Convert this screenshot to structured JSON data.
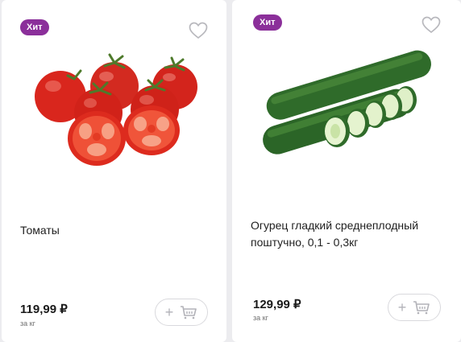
{
  "products": [
    {
      "badge": "Хит",
      "favorite_icon": "heart-outline-icon",
      "image": "tomatoes",
      "name": "Томаты",
      "price": "119,99 ₽",
      "unit": "за кг",
      "add_icon": "plus-icon",
      "cart_icon": "basket-icon"
    },
    {
      "badge": "Хит",
      "favorite_icon": "heart-outline-icon",
      "image": "cucumbers",
      "name": "Огурец гладкий среднеплодный поштучно, 0,1 - 0,3кг",
      "price": "129,99 ₽",
      "unit": "за кг",
      "add_icon": "plus-icon",
      "cart_icon": "basket-icon"
    }
  ],
  "colors": {
    "badge_bg": "#8b2f9a",
    "page_bg": "#ececef",
    "tomato": "#d8251d",
    "cucumber": "#2f6b2a"
  }
}
